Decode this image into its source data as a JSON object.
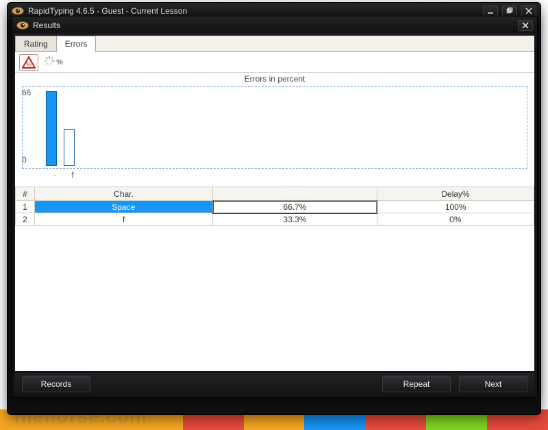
{
  "outer_window": {
    "title": "RapidTyping 4.6.5 - Guest - Current Lesson"
  },
  "dialog": {
    "title": "Results"
  },
  "tabs": {
    "rating": "Rating",
    "errors": "Errors",
    "active": "errors"
  },
  "toolbar": {
    "triangle_tooltip": "Errors in percent",
    "percent_symbol": "%"
  },
  "chart_data": {
    "type": "bar",
    "title": "Errors in percent",
    "xlabel": "",
    "ylabel": "",
    "categories": [
      "·",
      "f"
    ],
    "values": [
      66.7,
      33.3
    ],
    "ylim": [
      0,
      66
    ],
    "y_ticks": [
      66,
      0
    ]
  },
  "table": {
    "headers": {
      "num": "#",
      "char": "Char.",
      "errors": "Errors%",
      "delay": "Delay%"
    },
    "rows": [
      {
        "num": "1",
        "char": "Space",
        "errors": "66.7%",
        "delay": "100%",
        "selected": true
      },
      {
        "num": "2",
        "char": "f",
        "errors": "33.3%",
        "delay": "0%",
        "selected": false
      }
    ]
  },
  "buttons": {
    "records": "Records",
    "repeat": "Repeat",
    "next": "Next"
  },
  "watermark": "filehorse.com",
  "bg_colors": [
    "#f5a623",
    "#f5a623",
    "#f5a623",
    "#e74c3c",
    "#f5a623",
    "#1795f3",
    "#e74c3c",
    "#7ed321",
    "#e74c3c"
  ]
}
